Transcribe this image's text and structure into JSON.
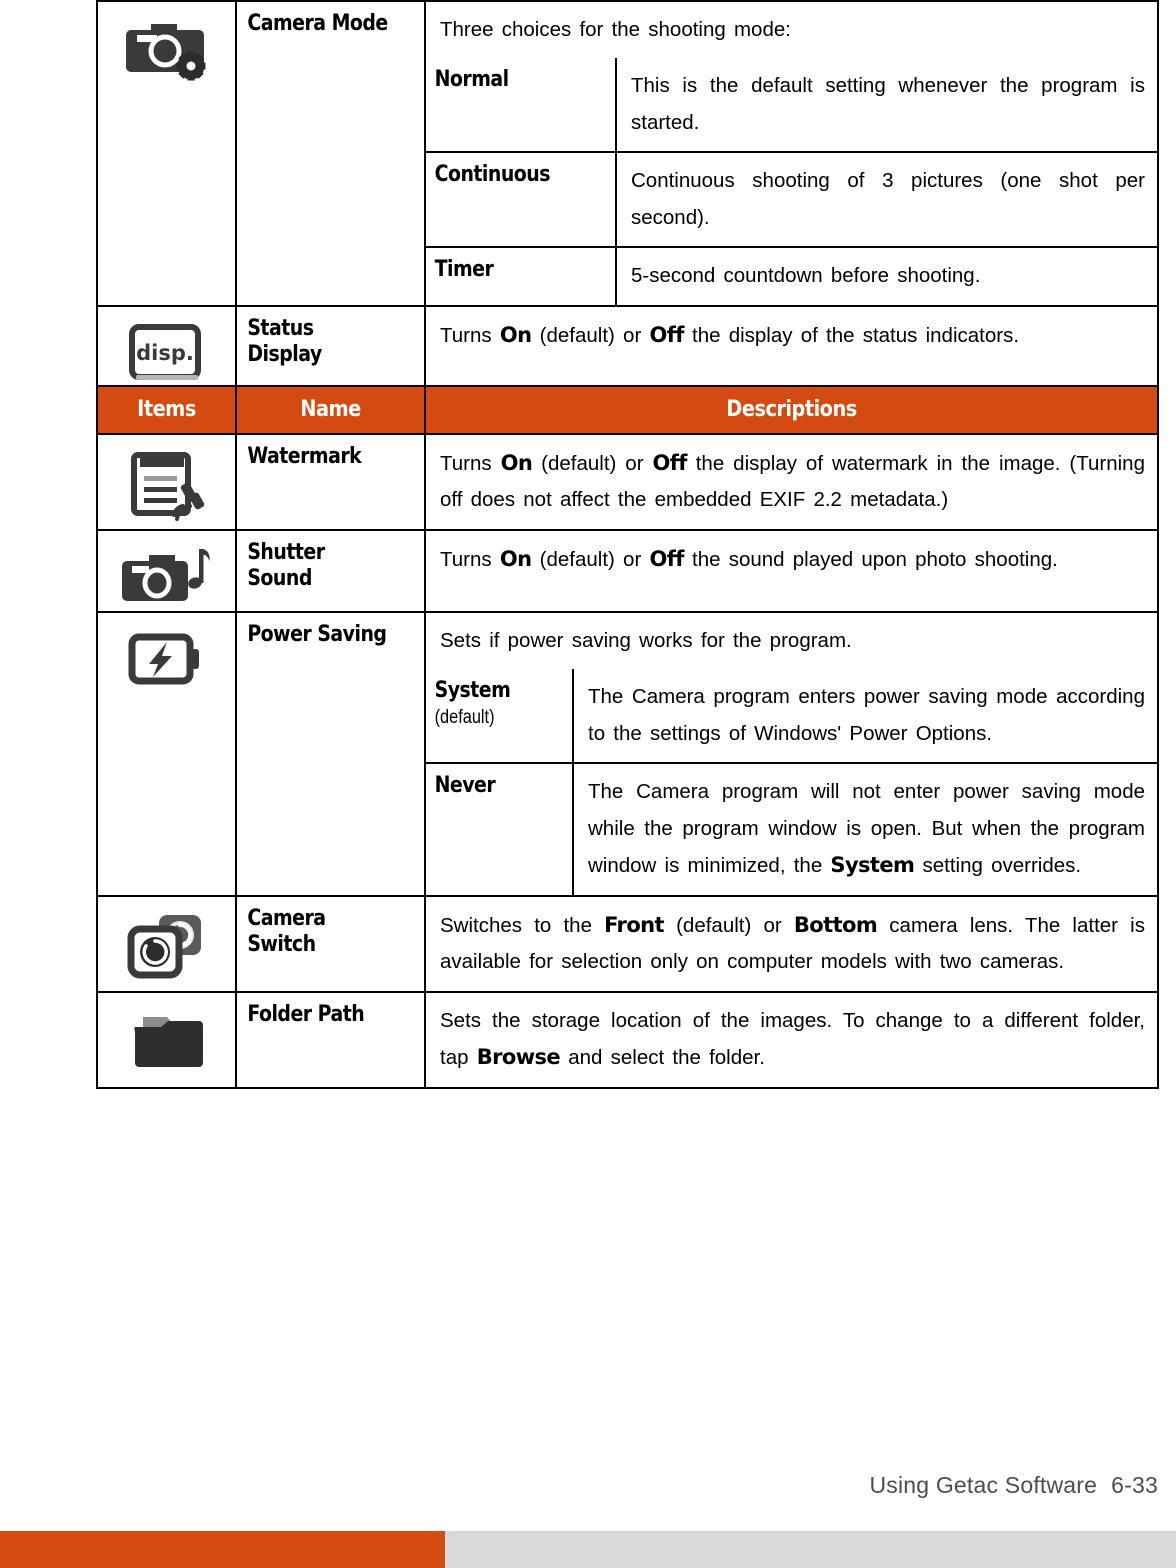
{
  "document": {
    "footer": {
      "section_title": "Using Getac Software",
      "page_number": "6-33"
    }
  },
  "table": {
    "header": {
      "items": "Items",
      "name": "Name",
      "descriptions": "Descriptions"
    },
    "rows": [
      {
        "icon": "camera-settings-icon",
        "name": "Camera Mode",
        "intro": "Three choices for the shooting mode:",
        "sub_rows": [
          {
            "name": "Normal",
            "desc_prefix": "This is the default setting whenever the program is started."
          },
          {
            "name": "Continuous",
            "desc_prefix": "Continuous shooting of 3 pictures (one shot per second)."
          },
          {
            "name": "Timer",
            "desc_prefix": "5-second countdown before shooting."
          }
        ]
      },
      {
        "icon": "disp-button-icon",
        "name": "Status Display",
        "desc_parts": [
          {
            "t": "Turns ",
            "b": false
          },
          {
            "t": "On",
            "b": true
          },
          {
            "t": " (default) or ",
            "b": false
          },
          {
            "t": "Off",
            "b": true
          },
          {
            "t": " the display of the status indicators.",
            "b": false
          }
        ]
      },
      {
        "icon": "watermark-icon",
        "name": "Watermark",
        "desc_parts": [
          {
            "t": "Turns ",
            "b": false
          },
          {
            "t": "On",
            "b": true
          },
          {
            "t": " (default) or ",
            "b": false
          },
          {
            "t": "Off",
            "b": true
          },
          {
            "t": " the display of watermark in the image. (Turning off does not affect the embedded EXIF 2.2 metadata.)",
            "b": false
          }
        ]
      },
      {
        "icon": "shutter-sound-icon",
        "name": "Shutter Sound",
        "desc_parts": [
          {
            "t": "Turns ",
            "b": false
          },
          {
            "t": "On",
            "b": true
          },
          {
            "t": " (default) or ",
            "b": false
          },
          {
            "t": "Off",
            "b": true
          },
          {
            "t": " the sound played upon photo shooting.",
            "b": false
          }
        ]
      },
      {
        "icon": "power-saving-icon",
        "name": "Power Saving",
        "intro": "Sets if power saving works for the program.",
        "sub_rows": [
          {
            "name": "System",
            "name_note": "(default)",
            "desc": "The Camera program enters power saving mode according to the settings of Windows' Power Options."
          },
          {
            "name": "Never",
            "desc_parts": [
              {
                "t": "The Camera program will not enter power saving mode while the program window is open. But when the program window is minimized, the ",
                "b": false
              },
              {
                "t": "System",
                "b": true
              },
              {
                "t": " setting overrides.",
                "b": false
              }
            ]
          }
        ]
      },
      {
        "icon": "camera-switch-icon",
        "name": "Camera Switch",
        "desc_parts": [
          {
            "t": "Switches to the ",
            "b": false
          },
          {
            "t": "Front",
            "b": true
          },
          {
            "t": " (default) or ",
            "b": false
          },
          {
            "t": "Bottom",
            "b": true
          },
          {
            "t": " camera lens. The latter is available for selection only on computer models with two cameras.",
            "b": false
          }
        ]
      },
      {
        "icon": "folder-icon",
        "name": "Folder Path",
        "desc_parts": [
          {
            "t": "Sets the storage location of the images. To change to a different folder, tap ",
            "b": false
          },
          {
            "t": "Browse",
            "b": true
          },
          {
            "t": " and select the folder.",
            "b": false
          }
        ]
      }
    ]
  },
  "colors": {
    "accent_orange": "#d44a10",
    "footer_grey": "#d9d9d9",
    "icon_dark": "#3a3a3a"
  },
  "strings": {
    "camera_mode_name": "Camera Mode",
    "status_display_name": "Status Display",
    "watermark_name": "Watermark",
    "shutter_sound_name": "Shutter Sound",
    "power_saving_name": "Power Saving",
    "camera_switch_name": "Camera Switch",
    "folder_path_name": "Folder Path",
    "normal": "Normal",
    "continuous": "Continuous",
    "timer": "Timer",
    "system": "System",
    "system_default": "(default)",
    "never": "Never",
    "disp_label": "disp.",
    "camera_mode_intro": "Three choices for the shooting mode:",
    "normal_desc": "This is the default setting whenever the program is started.",
    "continuous_desc": "Continuous shooting of 3 pictures (one shot per second).",
    "timer_desc": "5-second countdown before shooting.",
    "power_saving_intro": "Sets if power saving works for the program.",
    "system_desc": "The Camera program enters power saving mode according to the settings of Windows' Power Options."
  }
}
